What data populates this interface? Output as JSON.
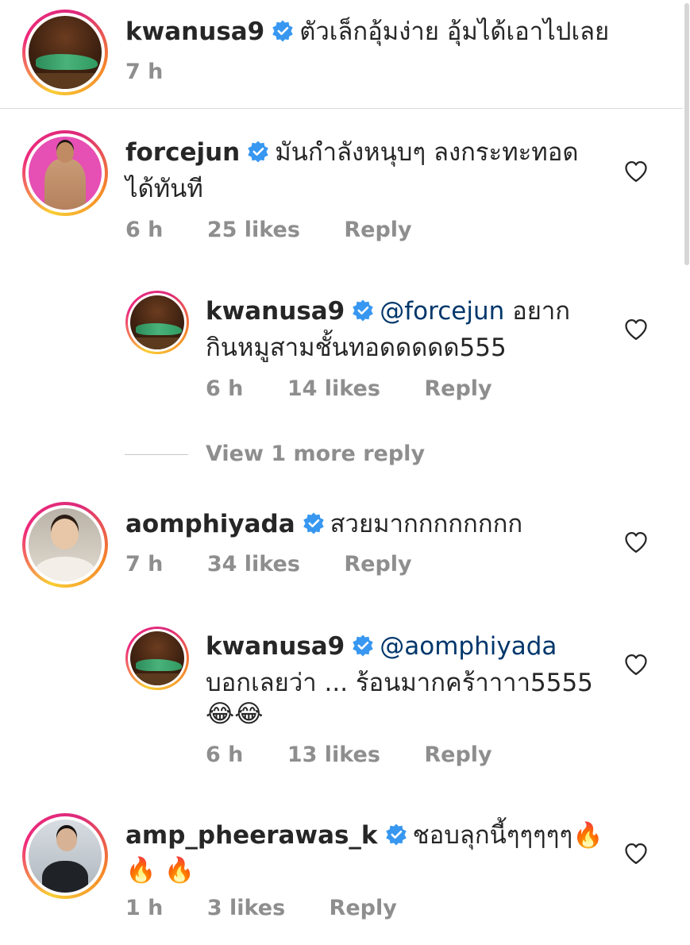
{
  "caption": {
    "username": "kwanusa9",
    "text": "ตัวเล็กอุ้มง่าย อุ้มได้เอาไปเลย",
    "time": "7 h"
  },
  "comments": [
    {
      "username": "forcejun",
      "text_line1": "มันกำลังหนุบๆ ลงกระทะทอด",
      "text_line2": "ได้ทันที",
      "time": "6 h",
      "likes": "25 likes",
      "reply_label": "Reply",
      "reply": {
        "username": "kwanusa9",
        "mention": "@forcejun",
        "text_line1_rest": " อยาก",
        "text_line2": "กินหมูสามชั้นทอดดดดด555",
        "time": "6 h",
        "likes": "14 likes",
        "reply_label": "Reply"
      },
      "view_more": "View 1 more reply"
    },
    {
      "username": "aomphiyada",
      "text_line1": "สวยมากกกกกกกก",
      "time": "7 h",
      "likes": "34 likes",
      "reply_label": "Reply",
      "reply": {
        "username": "kwanusa9",
        "mention": "@aomphiyada",
        "text_line2": "บอกเลยว่า ... ร้อนมากคร้าาาา5555",
        "text_line3": "😂😂",
        "time": "6 h",
        "likes": "13 likes",
        "reply_label": "Reply"
      }
    },
    {
      "username": "amp_pheerawas_k",
      "text_line1": "ชอบลุกนี้ๆๆๆๆๆ🔥",
      "text_line2": "🔥 🔥",
      "time": "1 h",
      "likes": "3 likes",
      "reply_label": "Reply"
    }
  ],
  "colors": {
    "verified_badge": "#3897f0",
    "mention": "#00376b",
    "meta_text": "#8e8e8e",
    "heart_stroke": "#262626"
  },
  "icons": {
    "verified": "verified-badge-icon",
    "like": "heart-outline-icon"
  }
}
